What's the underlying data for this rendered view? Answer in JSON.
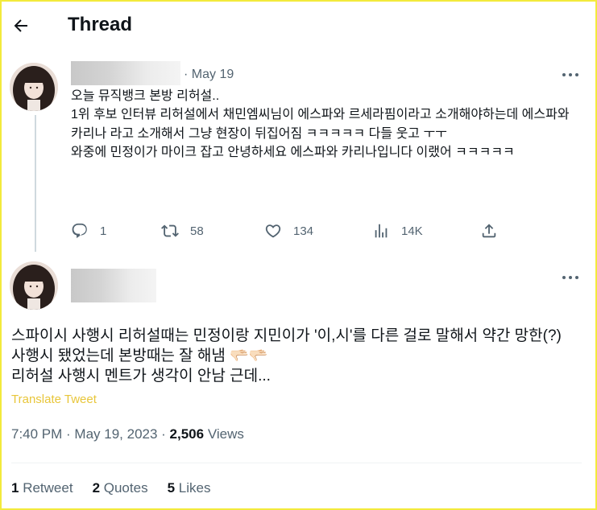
{
  "header": {
    "title": "Thread"
  },
  "tweet1": {
    "date": "· May 19",
    "text": "오늘 뮤직뱅크 본방 리허설..\n1위 후보 인터뷰 리허설에서 채민엠씨님이 에스파와 르세라핌이라고 소개해야하는데 에스파와 카리나 라고 소개해서 그냥 현장이 뒤집어짐 ㅋㅋㅋㅋㅋ 다들 웃고 ㅜㅜ\n와중에 민정이가 마이크 잡고 안녕하세요 에스파와 카리나입니다 이랬어 ㅋㅋㅋㅋㅋ",
    "actions": {
      "replies": "1",
      "retweets": "58",
      "likes": "134",
      "views": "14K"
    }
  },
  "tweet2": {
    "text": "스파이시 사행시 리허설때는 민정이랑 지민이가 '이,시'를 다른 걸로 말해서 약간 망한(?) 사행시 됐었는데 본방때는 잘 해냄 🫳🏻🫳🏻\n리허설 사행시 멘트가 생각이 안남 근데...",
    "translate": "Translate Tweet",
    "time": "7:40 PM · May 19, 2023 · ",
    "views_count": "2,506",
    "views_label": " Views",
    "stats": {
      "retweets_count": "1",
      "retweets_label": " Retweet",
      "quotes_count": "2",
      "quotes_label": " Quotes",
      "likes_count": "5",
      "likes_label": " Likes"
    }
  },
  "colors": {
    "accent_translate": "#e8c63a",
    "border_highlight": "#f3ea3c",
    "muted_text": "#536471"
  },
  "icons": [
    "back-arrow-icon",
    "more-icon",
    "reply-icon",
    "retweet-icon",
    "like-icon",
    "views-icon",
    "share-icon"
  ]
}
